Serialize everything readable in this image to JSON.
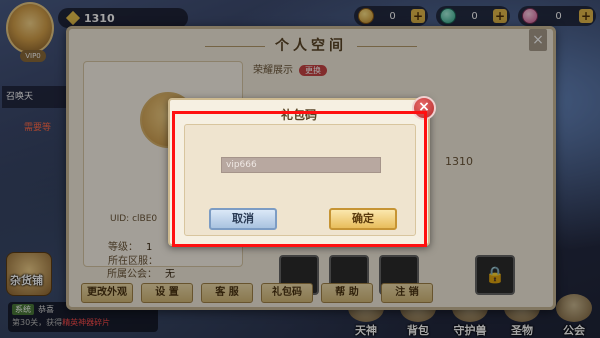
{
  "hud": {
    "vip_label": "VIP0",
    "power": "1310",
    "currencies": [
      {
        "icon": "gold-coin-icon",
        "value": "0"
      },
      {
        "icon": "diamond-icon",
        "value": "0"
      },
      {
        "icon": "pink-gem-icon",
        "value": "0"
      }
    ],
    "plus_label": "+"
  },
  "side": {
    "summon_tab": "召唤天",
    "summon_sub": "需要等",
    "shop_label": "杂货铺",
    "chat_tag": "系统",
    "chat_line1": "恭喜",
    "chat_line2": "第30关，获得",
    "chat_highlight": "精英神器碎片"
  },
  "panel": {
    "title": "个人空间",
    "close": "×",
    "uid": "UID: clBE0",
    "info": [
      {
        "label": "等级：",
        "value": "1"
      },
      {
        "label": "所在区服：",
        "value": ""
      },
      {
        "label": "所属公会：",
        "value": "无"
      }
    ],
    "honor_label": "荣耀展示",
    "honor_badge": "更换",
    "power_ghost": "1310",
    "buttons": [
      "更改外观",
      "设 置",
      "客 服",
      "礼包码",
      "帮 助",
      "注 销"
    ]
  },
  "bottom_nav": [
    "天神",
    "背包",
    "守护兽",
    "圣物",
    "公会"
  ],
  "dialog": {
    "title": "礼包码",
    "input_value": "vip666",
    "cancel": "取消",
    "confirm": "确定",
    "close": "×"
  },
  "colors": {
    "highlight_border": "#ff1010",
    "confirm_button": "#e8bd5c",
    "cancel_button": "#a9c3e0"
  }
}
